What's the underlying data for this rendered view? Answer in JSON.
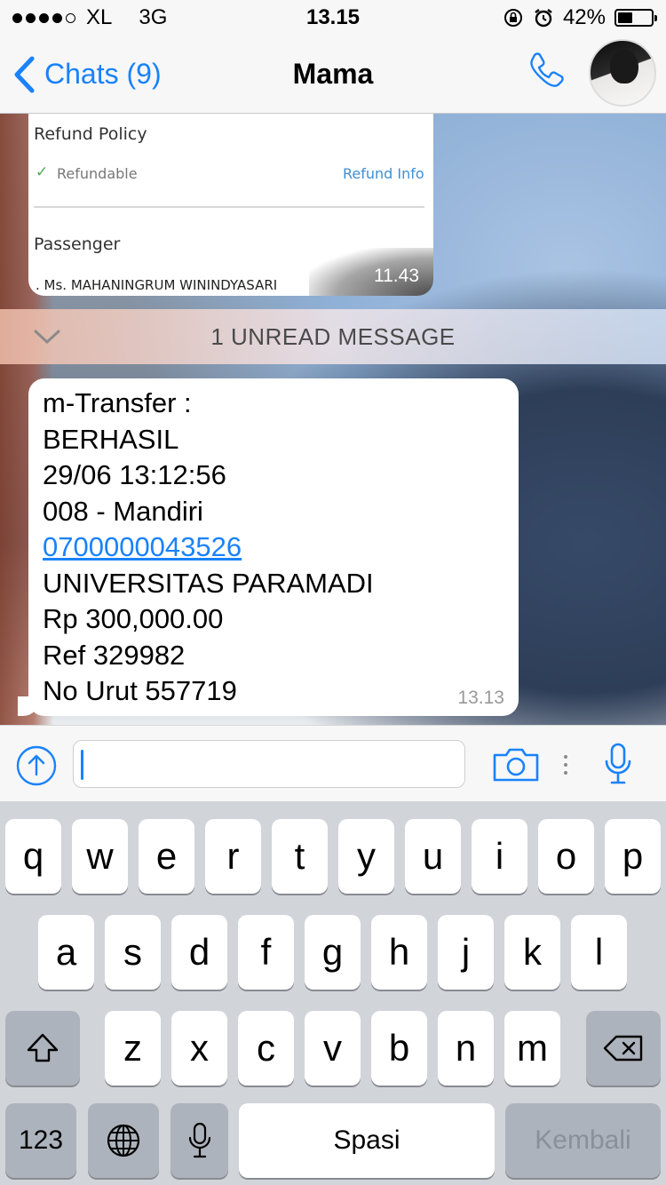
{
  "status_bar": {
    "carrier": "XL",
    "network": "3G",
    "time": "13.15",
    "battery": "42%",
    "signal_bars_filled": 4,
    "signal_bars_total": 5
  },
  "nav": {
    "back_label": "Chats (9)",
    "title": "Mama",
    "accent": "#1a82fb"
  },
  "messages": {
    "image_message": {
      "refund_policy": "Refund Policy",
      "refundable": "Refundable",
      "refund_info": "Refund Info",
      "passenger": "Passenger",
      "passenger_name": ". Ms. MAHANINGRUM WININDYASARI",
      "time": "11.43"
    },
    "unread_label": "1 UNREAD MESSAGE",
    "text_message": {
      "lines": [
        "m-Transfer :",
        "BERHASIL",
        "29/06 13:12:56",
        "008 - Mandiri",
        "0700000043526",
        "UNIVERSITAS PARAMADI",
        "Rp 300,000.00",
        "Ref 329982",
        "No Urut 557719"
      ],
      "time": "13.13"
    }
  },
  "input": {
    "value": "",
    "icons": [
      "upload-icon",
      "camera-icon",
      "more-icon",
      "microphone-icon"
    ]
  },
  "keyboard": {
    "row1": [
      "q",
      "w",
      "e",
      "r",
      "t",
      "y",
      "u",
      "i",
      "o",
      "p"
    ],
    "row2": [
      "a",
      "s",
      "d",
      "f",
      "g",
      "h",
      "j",
      "k",
      "l"
    ],
    "row3": [
      "z",
      "x",
      "c",
      "v",
      "b",
      "n",
      "m"
    ],
    "numbers_label": "123",
    "space_label": "Spasi",
    "return_label": "Kembali"
  }
}
